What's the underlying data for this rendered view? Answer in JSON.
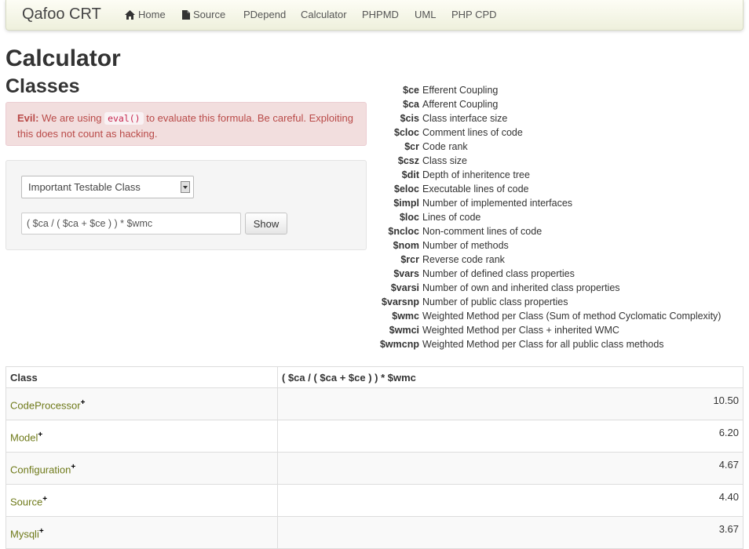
{
  "navbar": {
    "brand": "Qafoo CRT",
    "items": [
      {
        "label": "Home",
        "icon": "home-icon"
      },
      {
        "label": "Source",
        "icon": "file-icon"
      },
      {
        "label": "PDepend",
        "icon": ""
      },
      {
        "label": "Calculator",
        "icon": ""
      },
      {
        "label": "PHPMD",
        "icon": ""
      },
      {
        "label": "UML",
        "icon": ""
      },
      {
        "label": "PHP CPD",
        "icon": ""
      }
    ]
  },
  "page": {
    "title": "Calculator",
    "subtitle": "Classes"
  },
  "alert": {
    "strong": "Evil:",
    "text_before": " We are using ",
    "code": "eval()",
    "text_after": " to evaluate this formula. Be careful. Exploiting this does not count as hacking."
  },
  "form": {
    "select_value": "Important Testable Class",
    "formula_value": "( $ca / ( $ca + $ce ) ) * $wmc",
    "show_label": "Show"
  },
  "legend": [
    {
      "key": "$ce",
      "desc": "Efferent Coupling"
    },
    {
      "key": "$ca",
      "desc": "Afferent Coupling"
    },
    {
      "key": "$cis",
      "desc": "Class interface size"
    },
    {
      "key": "$cloc",
      "desc": "Comment lines of code"
    },
    {
      "key": "$cr",
      "desc": "Code rank"
    },
    {
      "key": "$csz",
      "desc": "Class size"
    },
    {
      "key": "$dit",
      "desc": "Depth of inheritence tree"
    },
    {
      "key": "$eloc",
      "desc": "Executable lines of code"
    },
    {
      "key": "$impl",
      "desc": "Number of implemented interfaces"
    },
    {
      "key": "$loc",
      "desc": "Lines of code"
    },
    {
      "key": "$ncloc",
      "desc": "Non-comment lines of code"
    },
    {
      "key": "$nom",
      "desc": "Number of methods"
    },
    {
      "key": "$rcr",
      "desc": "Reverse code rank"
    },
    {
      "key": "$vars",
      "desc": "Number of defined class properties"
    },
    {
      "key": "$varsi",
      "desc": "Number of own and inherited class properties"
    },
    {
      "key": "$varsnp",
      "desc": "Number of public class properties"
    },
    {
      "key": "$wmc",
      "desc": "Weighted Method per Class (Sum of method Cyclomatic Complexity)"
    },
    {
      "key": "$wmci",
      "desc": "Weighted Method per Class + inherited WMC"
    },
    {
      "key": "$wmcnp",
      "desc": "Weighted Method per Class for all public class methods"
    }
  ],
  "table": {
    "headers": [
      "Class",
      "( $ca / ( $ca + $ce ) ) * $wmc"
    ],
    "rows": [
      {
        "name": "CodeProcessor",
        "sup": "+",
        "value": "10.50"
      },
      {
        "name": "Model",
        "sup": "+",
        "value": "6.20"
      },
      {
        "name": "Configuration",
        "sup": "+",
        "value": "4.67"
      },
      {
        "name": "Source",
        "sup": "+",
        "value": "4.40"
      },
      {
        "name": "Mysqli",
        "sup": "+",
        "value": "3.67"
      }
    ]
  }
}
